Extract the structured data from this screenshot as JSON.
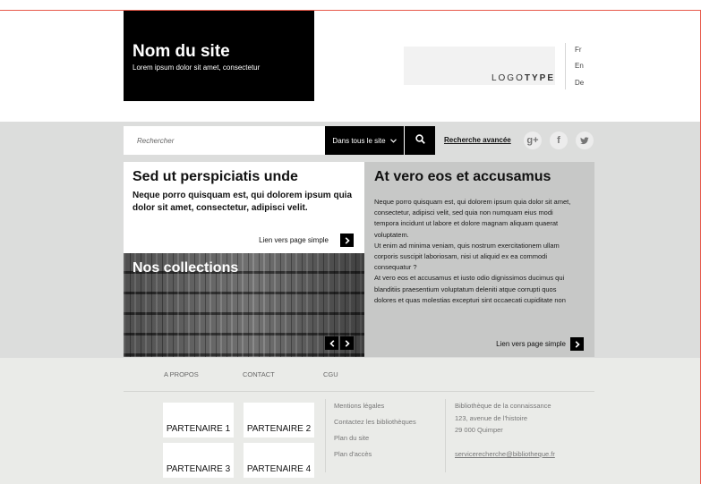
{
  "header": {
    "site_name": "Nom du site",
    "tagline": "Lorem ipsum dolor sit amet, consectetur",
    "logo_light": "LOGO",
    "logo_bold": "TYPE",
    "languages": [
      "Fr",
      "En",
      "De"
    ]
  },
  "search": {
    "placeholder": "Rechercher",
    "scope_label": "Dans tous le site",
    "advanced_link": "Recherche avancée"
  },
  "social": [
    "g+",
    "f",
    "t"
  ],
  "left_panel": {
    "title": "Sed ut perspiciatis unde",
    "subtitle": "Neque porro quisquam est, qui dolorem ipsum quia dolor sit amet, consectetur, adipisci velit.",
    "link": "Lien vers page simple"
  },
  "collections": {
    "title": "Nos collections"
  },
  "right_panel": {
    "title": "At vero eos et accusamus",
    "lines": [
      "Neque porro quisquam est, qui dolorem ipsum quia dolor sit amet,",
      "consectetur, adipisci velit, sed quia non numquam eius modi",
      "tempora incidunt ut labore et dolore magnam aliquam quaerat",
      "voluptatem.",
      "Ut enim ad minima veniam, quis nostrum exercitationem ullam",
      "corporis suscipit laboriosam, nisi ut aliquid ex ea commodi",
      "consequatur ?",
      "At vero eos et accusamus et iusto odio dignissimos ducimus qui",
      "blanditiis praesentium voluptatum deleniti atque corrupti quos",
      "dolores et quas molestias excepturi sint occaecati cupiditate non"
    ],
    "link": "Lien vers page simple"
  },
  "footer": {
    "nav": [
      "A PROPOS",
      "CONTACT",
      "CGU"
    ],
    "partners": [
      "PARTENAIRE 1",
      "PARTENAIRE 2",
      "PARTENAIRE 3",
      "PARTENAIRE 4"
    ],
    "links": [
      "Mentions légales",
      "Contactez les bibliothèques",
      "Plan du site",
      "Plan d'accès"
    ],
    "address": [
      "Bibliothèque de la connaissance",
      "123, avenue de l'histoire",
      "29 000 Quimper"
    ],
    "email": "servicerecherche@bibliotheque.fr"
  },
  "colors": {
    "accent_line": "#e8594a",
    "band": "#dcdddc",
    "footer": "#eaebe8"
  }
}
